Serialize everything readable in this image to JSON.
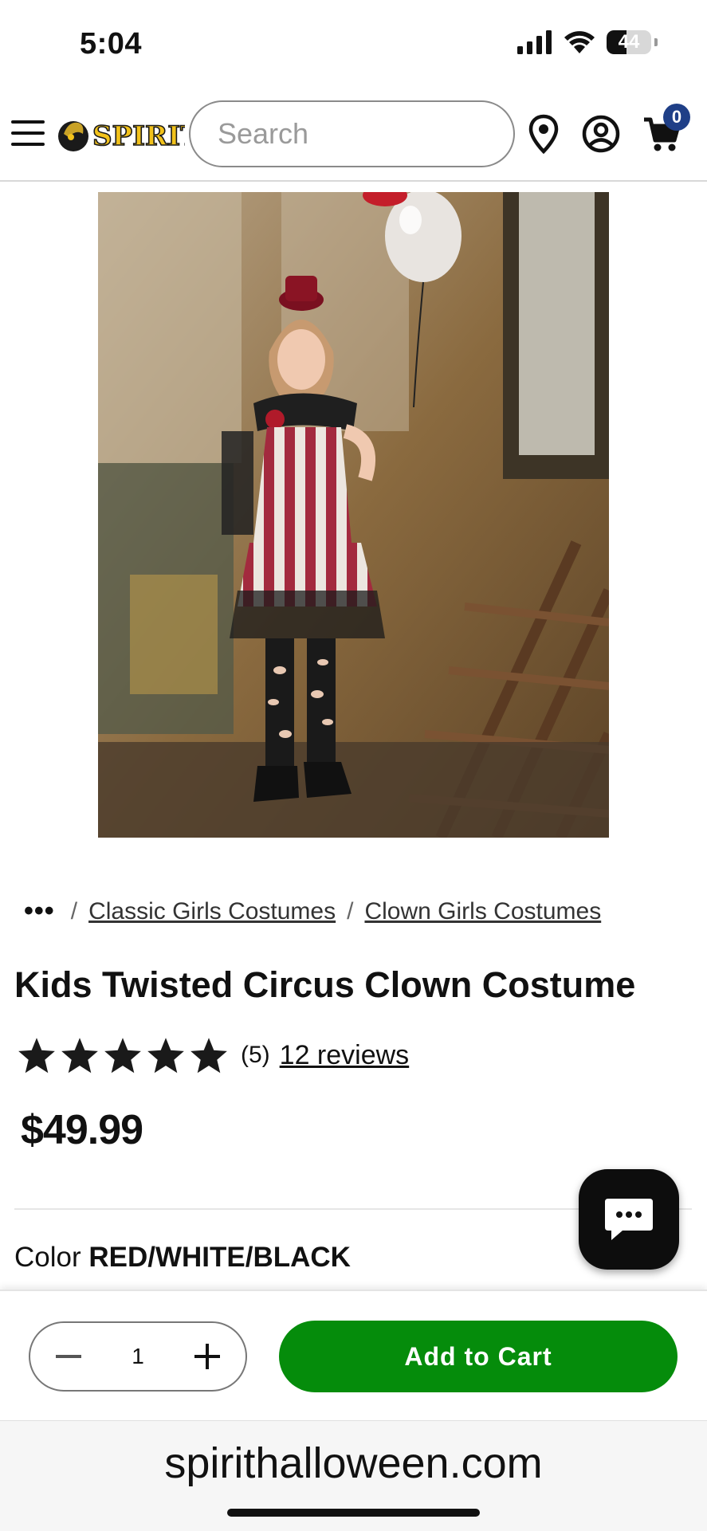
{
  "status_bar": {
    "time": "5:04",
    "battery": "44",
    "battery_level": 0.44
  },
  "header": {
    "logo_text": "SPIRIT",
    "search_placeholder": "Search",
    "cart_count": "0"
  },
  "breadcrumb": {
    "ellipsis": "•••",
    "separator": "/",
    "items": [
      "Classic Girls Costumes",
      "Clown Girls Costumes"
    ]
  },
  "product": {
    "title": "Kids Twisted Circus Clown Costume",
    "rating_value": 5,
    "rating_count": "(5)",
    "reviews_link": "12 reviews",
    "price": "$49.99",
    "color_label": "Color",
    "color_value": "RED/WHITE/BLACK"
  },
  "purchase": {
    "quantity": "1",
    "add_to_cart": "Add to Cart"
  },
  "browser": {
    "url": "spirithalloween.com"
  },
  "colors": {
    "add_to_cart_bg": "#058c0b",
    "cart_badge_bg": "#1f3f87",
    "logo_yellow": "#f2c21b"
  },
  "icons": [
    "hamburger-icon",
    "search-icon",
    "location-pin-icon",
    "account-icon",
    "cart-icon",
    "star-icon",
    "chat-icon",
    "minus-icon",
    "plus-icon",
    "signal-icon",
    "wifi-icon"
  ]
}
